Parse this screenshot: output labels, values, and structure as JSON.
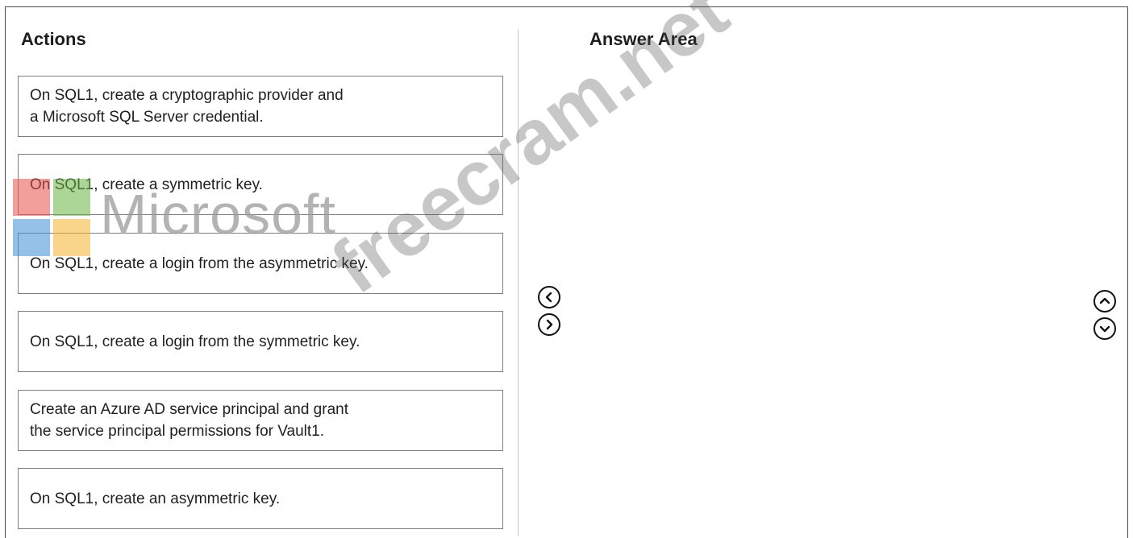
{
  "actions_panel": {
    "title": "Actions",
    "items": [
      {
        "line1": "On SQL1, create a cryptographic provider and",
        "line2": "a Microsoft SQL Server credential."
      },
      {
        "line1": "On SQL1, create a symmetric key.",
        "line2": ""
      },
      {
        "line1": "On SQL1, create a login from the asymmetric key.",
        "line2": ""
      },
      {
        "line1": "On SQL1, create a login from the symmetric key.",
        "line2": ""
      },
      {
        "line1": "Create an Azure AD service principal and grant",
        "line2": "the service principal permissions for Vault1."
      },
      {
        "line1": "On SQL1, create an asymmetric key.",
        "line2": ""
      }
    ]
  },
  "answer_panel": {
    "title": "Answer Area"
  },
  "controls": {
    "move_left_icon": "chevron-left-circle-icon",
    "move_right_icon": "chevron-right-circle-icon",
    "move_up_icon": "chevron-up-circle-icon",
    "move_down_icon": "chevron-down-circle-icon"
  },
  "watermarks": {
    "logo_text": "Microsoft",
    "site_text": "freecram.net"
  },
  "colors": {
    "border": "#7d7d7d",
    "divider": "#c8c8c8",
    "text": "#1f1f1f",
    "logo_red": "#e8504b",
    "logo_green": "#6ab344",
    "logo_blue": "#3b8fd6",
    "logo_yellow": "#f5b330"
  }
}
